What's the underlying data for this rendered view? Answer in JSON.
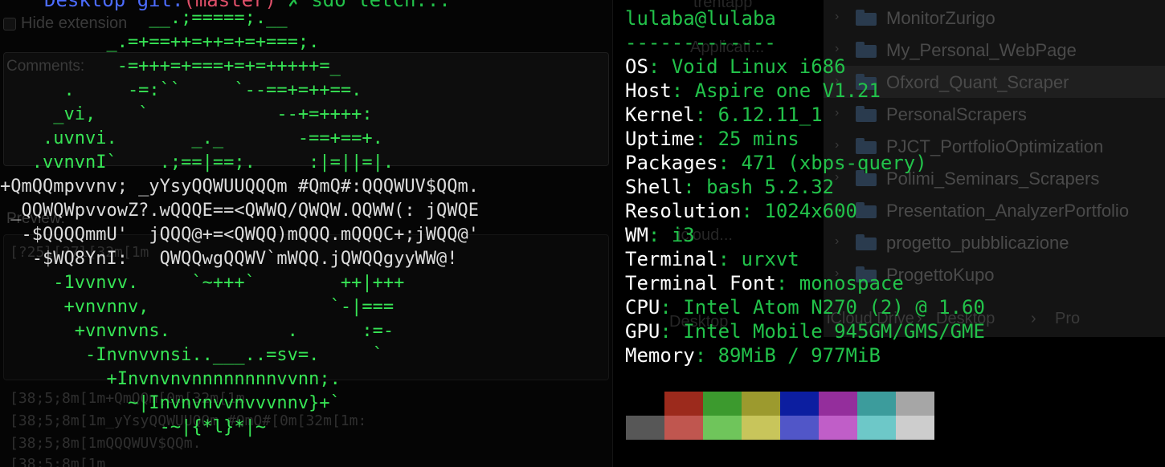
{
  "left_pane": {
    "command_line": {
      "prefix": "Desktop git:",
      "open_paren": "(",
      "branch": "master",
      "close_paren": ")",
      "tail": " ✗ sdo letch..."
    },
    "background": {
      "hide_extension": "Hide extension",
      "comments_label": "Comments:",
      "preview_label": "Preview:",
      "escape_lines": [
        "[?25l[?7l[32m[1m",
        "[38;5;8m[1m+QmQQm[0m[32m[1m",
        "[38;5;8m[1m_yYsyQQWUUQQm #QmQ#[0m[32m[1m:",
        "[38;5;8m[1mQQQWUV$QQm.",
        "[38;5;8m[1m"
      ]
    },
    "ascii_art": [
      "              __.;=====;.__",
      "          _.=+==++=++=+=+===;.",
      "           -=+++=+===+=+=+++++=_",
      "      .     -=:``     `--==+=++==.",
      "     _vi,    `            --+=++++:",
      "    .uvnvi.       _._       -==+==+.",
      "   .vvnvnI`    .;==|==;.     :|=||=|.",
      "+QmQQmpvvnv; _yYsyQQWUUQQQm #QmQ#:QQQWUV$QQm.",
      " _QQWQWpvvowZ?.wQQQE==<QWWQ/QWQW.QQWW(: jQWQE",
      "  -$QQQQmmU'  jQQQ@+=<QWQQ)mQQQ.mQQQC+;jWQQ@'",
      "   -$WQ8YnI:   QWQQwgQQWV`mWQQ.jQWQQgyyWW@!",
      "     -1vvnvv.     `~+++`        ++|+++",
      "      +vnvnnv,                 `-|===",
      "       +vnvnvns.           .      :=-",
      "        -Invnvvnsi..___..=sv=.     `",
      "          +Invnvnvnnnnnnnnvvnn;.",
      "            ~|Invnvnvvnvvvnnv}+`",
      "               -~|{*l}*|~"
    ]
  },
  "right_pane": {
    "finder": {
      "folders": [
        "MonitorZurigo",
        "My_Personal_WebPage",
        "Ofxord_Quant_Scraper",
        "PersonalScrapers",
        "PJCT_PortfolioOptimization",
        "Polimi_Seminars_Scrapers",
        "Presentation_AnalyzerPortfolio",
        "progetto_pubblicazione",
        "ProgettoKupo"
      ],
      "path": [
        "iCloud Drive",
        "Desktop",
        "Pro"
      ],
      "ghost_items": [
        "trentapp",
        "Applicati...",
        "Desktop",
        "icloud..."
      ]
    },
    "neofetch": {
      "user_host": "lulaba@lulaba",
      "separator": "-------------",
      "fields": [
        {
          "key": "OS",
          "value": "Void Linux i686"
        },
        {
          "key": "Host",
          "value": "Aspire one V1.21"
        },
        {
          "key": "Kernel",
          "value": "6.12.11_1"
        },
        {
          "key": "Uptime",
          "value": "25 mins"
        },
        {
          "key": "Packages",
          "value": "471 (xbps-query)"
        },
        {
          "key": "Shell",
          "value": "bash 5.2.32"
        },
        {
          "key": "Resolution",
          "value": "1024x600"
        },
        {
          "key": "WM",
          "value": "i3"
        },
        {
          "key": "Terminal",
          "value": "urxvt"
        },
        {
          "key": "Terminal Font",
          "value": "monospace"
        },
        {
          "key": "CPU",
          "value": "Intel Atom N270 (2) @ 1.60"
        },
        {
          "key": "GPU",
          "value": "Intel Mobile 945GM/GMS/GME"
        },
        {
          "key": "Memory",
          "value": "89MiB / 977MiB"
        }
      ],
      "key_value_separator": ": ",
      "palette_colors": [
        "#000000",
        "#9c2a1c",
        "#3c9a2e",
        "#9c9a2e",
        "#0c1ea0",
        "#942e9c",
        "#3c9c9c",
        "#a6a6a6",
        "#575757",
        "#c0564f",
        "#6fc55b",
        "#c8c55b",
        "#5156c8",
        "#c05ec8",
        "#6dc8c8",
        "#cdcdcd"
      ]
    }
  }
}
